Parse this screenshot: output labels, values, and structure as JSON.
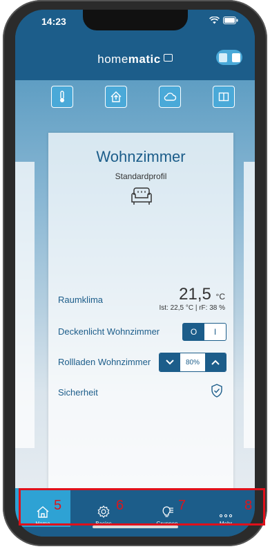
{
  "status": {
    "time": "14:23"
  },
  "header": {
    "brand_light": "home",
    "brand_bold": "matic"
  },
  "room": {
    "title": "Wohnzimmer",
    "profile": "Standardprofil",
    "rows": {
      "climate": {
        "label": "Raumklima",
        "temp": "21,5",
        "unit": "°C",
        "detail": "Ist: 22,5 °C | rF: 38 %"
      },
      "light": {
        "label": "Deckenlicht Wohnzimmer",
        "on": "O",
        "off": "I"
      },
      "shutter": {
        "label": "Rollladen Wohnzimmer",
        "percent": "80%"
      },
      "security": {
        "label": "Sicherheit"
      }
    }
  },
  "tabs": [
    {
      "label": "Home",
      "number": "5",
      "active": true
    },
    {
      "label": "Basics",
      "number": "6"
    },
    {
      "label": "Gruppen",
      "number": "7"
    },
    {
      "label": "Mehr",
      "number": "8"
    }
  ],
  "colors": {
    "primary": "#1c5d8a",
    "accent": "#2ea2d4",
    "annotation": "#e0101a"
  }
}
